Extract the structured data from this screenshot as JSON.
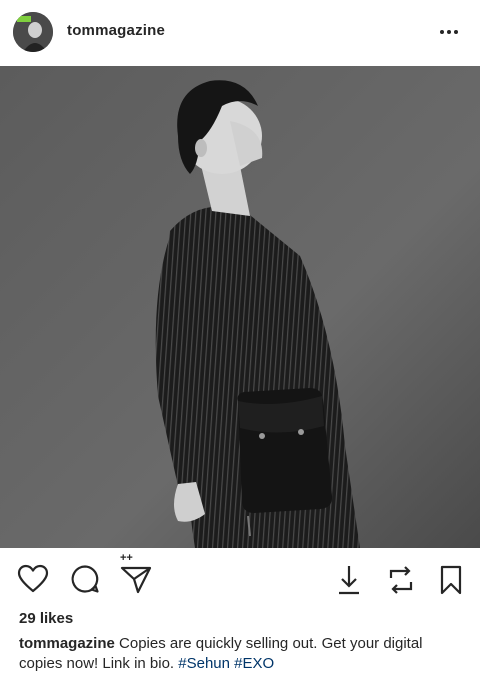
{
  "post": {
    "username": "tommagazine",
    "avatar_icon": "profile-avatar",
    "more_icon": "more-options-icon",
    "photo_icon": "post-photo"
  },
  "actions": {
    "like_icon": "heart-icon",
    "comment_icon": "comment-icon",
    "share_icon": "paper-plane-icon",
    "new_badge": "++",
    "download_icon": "download-icon",
    "repost_icon": "repost-icon",
    "save_icon": "bookmark-icon"
  },
  "likes": {
    "text": "29 likes"
  },
  "caption": {
    "username": "tommagazine",
    "text": " Copies are quickly selling out. Get your digital copies now! Link in bio. ",
    "hashtag1": "#Sehun",
    "hashtag2": "#EXO"
  },
  "colors": {
    "text": "#262626",
    "link": "#003569",
    "background": "#ffffff"
  }
}
